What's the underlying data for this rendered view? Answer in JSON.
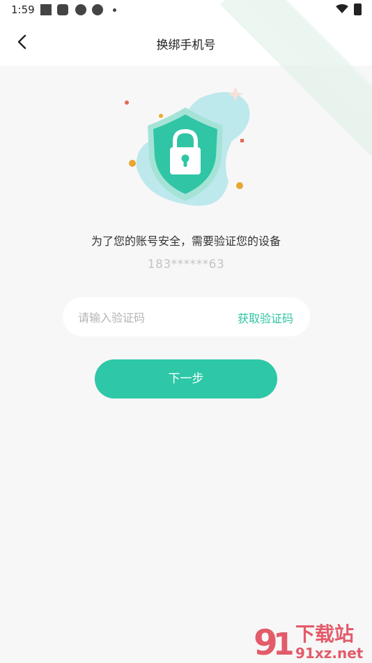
{
  "status_bar": {
    "time": "1:59"
  },
  "header": {
    "title": "换绑手机号",
    "back_icon": "chevron-left-icon"
  },
  "main": {
    "prompt": "为了您的账号安全，需要验证您的设备",
    "phone": "183******63",
    "code_input": {
      "placeholder": "请输入验证码",
      "value": ""
    },
    "get_code_label": "获取验证码",
    "next_label": "下一步"
  },
  "watermark": {
    "brand": "下载站",
    "domain": "91xz.net"
  },
  "colors": {
    "accent": "#2ec7a8",
    "shield": "#2fc5a5",
    "blob": "#bde8ec"
  }
}
